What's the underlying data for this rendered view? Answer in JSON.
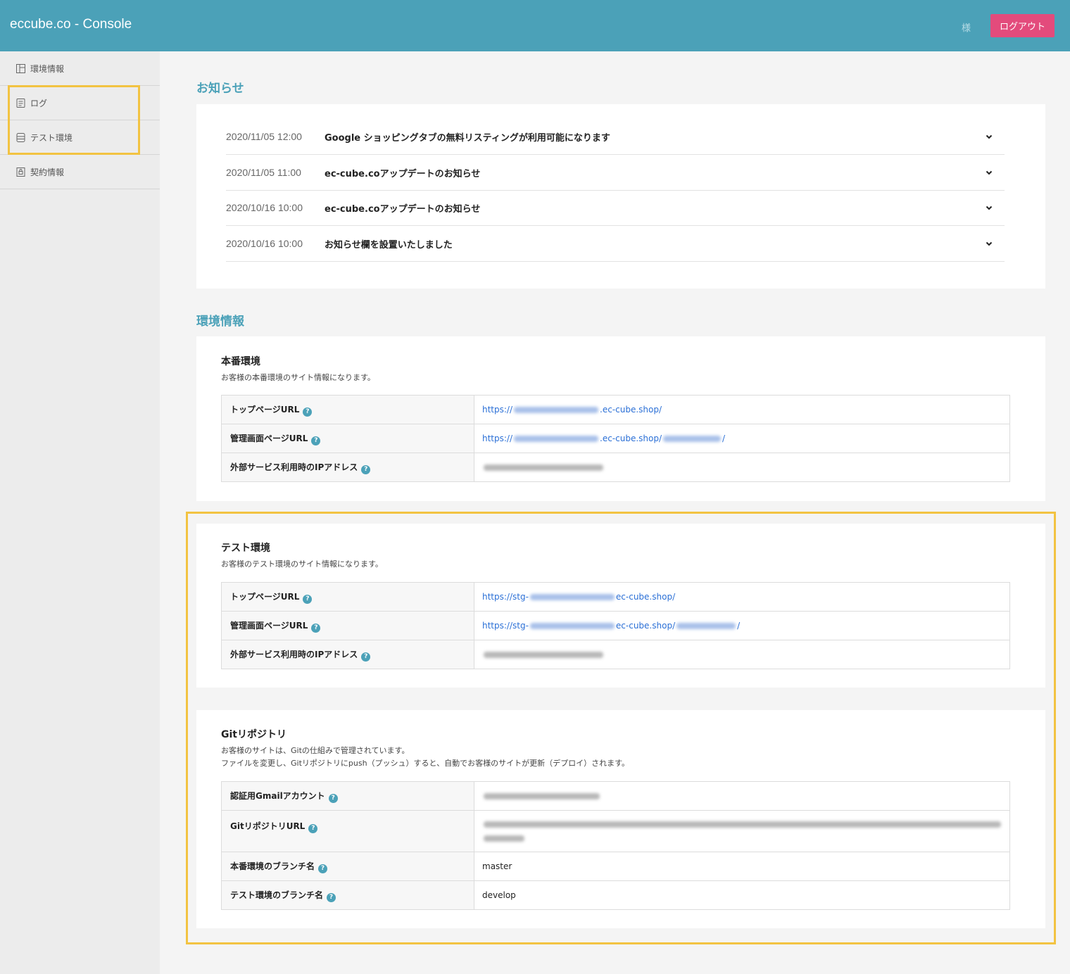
{
  "header": {
    "brand": "eccube.co - Console",
    "user_suffix": "様",
    "logout_label": "ログアウト"
  },
  "sidebar": {
    "items": [
      {
        "label": "環境情報",
        "icon": "layout-icon"
      },
      {
        "label": "ログ",
        "icon": "document-icon"
      },
      {
        "label": "テスト環境",
        "icon": "database-icon"
      },
      {
        "label": "契約情報",
        "icon": "contract-icon"
      }
    ]
  },
  "news": {
    "title": "お知らせ",
    "items": [
      {
        "date": "2020/11/05 12:00",
        "title": "Google ショッピングタブの無料リスティングが利用可能になります"
      },
      {
        "date": "2020/11/05 11:00",
        "title": "ec-cube.coアップデートのお知らせ"
      },
      {
        "date": "2020/10/16 10:00",
        "title": "ec-cube.coアップデートのお知らせ"
      },
      {
        "date": "2020/10/16 10:00",
        "title": "お知らせ欄を設置いたしました"
      }
    ]
  },
  "env": {
    "title": "環境情報",
    "production": {
      "title": "本番環境",
      "desc": "お客様の本番環境のサイト情報になります。",
      "rows": {
        "top_url_label": "トップページURL",
        "top_url_prefix": "https://",
        "top_url_suffix": ".ec-cube.shop/",
        "admin_url_label": "管理画面ページURL",
        "admin_url_prefix": "https://",
        "admin_url_suffix": ".ec-cube.shop/",
        "admin_url_end": "/",
        "ip_label": "外部サービス利用時のIPアドレス"
      }
    },
    "staging": {
      "title": "テスト環境",
      "desc": "お客様のテスト環境のサイト情報になります。",
      "rows": {
        "top_url_label": "トップページURL",
        "top_url_prefix": "https://stg-",
        "top_url_suffix": "ec-cube.shop/",
        "admin_url_label": "管理画面ページURL",
        "admin_url_prefix": "https://stg-",
        "admin_url_suffix": "ec-cube.shop/",
        "admin_url_end": "/",
        "ip_label": "外部サービス利用時のIPアドレス"
      }
    },
    "git": {
      "title": "Gitリポジトリ",
      "desc_line1": "お客様のサイトは、Gitの仕組みで管理されています。",
      "desc_line2": "ファイルを変更し、Gitリポジトリにpush（プッシュ）すると、自動でお客様のサイトが更新（デプロイ）されます。",
      "rows": {
        "gmail_label": "認証用Gmailアカウント",
        "repo_label": "GitリポジトリURL",
        "prod_branch_label": "本番環境のブランチ名",
        "prod_branch_value": "master",
        "test_branch_label": "テスト環境のブランチ名",
        "test_branch_value": "develop"
      }
    }
  },
  "colors": {
    "header": "#4ba1b8",
    "logout": "#e34b7c",
    "accent": "#4ba1b8",
    "link": "#2a6fd6",
    "highlight": "#f2c342"
  }
}
